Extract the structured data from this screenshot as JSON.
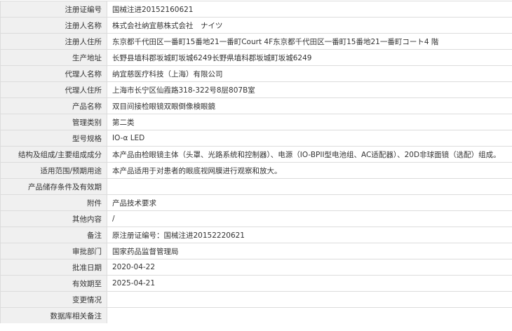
{
  "rows": [
    {
      "label": "注册证编号",
      "value": "国械注进20152160621"
    },
    {
      "label": "注册人名称",
      "value": "株式会社纳宜慈株式会社　ナイツ"
    },
    {
      "label": "注册人住所",
      "value": "东京都千代田区一番町15番地21一番町Court 4F东京都千代田区一番町15番地21一番町コート4 階"
    },
    {
      "label": "生产地址",
      "value": "长野县埴科郡坂城町坂城6249长野県埴科郡坂城町坂城6249"
    },
    {
      "label": "代理人名称",
      "value": "纳宜慈医疗科技（上海）有限公司"
    },
    {
      "label": "代理人住所",
      "value": "上海市长宁区仙霞路318-322号8层807B室"
    },
    {
      "label": "产品名称",
      "value": "双目间接检眼镜双眼倒像検眼鏡"
    },
    {
      "label": "管理类别",
      "value": "第二类"
    },
    {
      "label": "型号规格",
      "value": "IO-α LED"
    },
    {
      "label": "结构及组成/主要组成成分",
      "value": "本产品由检眼镜主体（头罩、光路系统和控制器）、电源（IO-BPII型电池组、AC适配器）、20D非球面镜（选配）组成。"
    },
    {
      "label": "适用范围/预期用途",
      "value": "本产品适用于对患者的眼底视网膜进行观察和放大。"
    },
    {
      "label": "产品储存条件及有效期",
      "value": ""
    },
    {
      "label": "附件",
      "value": "产品技术要求"
    },
    {
      "label": "其他内容",
      "value": "/"
    },
    {
      "label": "备注",
      "value": "原注册证编号：国械注进20152220621"
    },
    {
      "label": "审批部门",
      "value": "国家药品监督管理局"
    },
    {
      "label": "批准日期",
      "value": "2020-04-22"
    },
    {
      "label": "有效期至",
      "value": "2025-04-21"
    },
    {
      "label": "变更情况",
      "value": ""
    },
    {
      "label": "数据库相关备注",
      "value": ""
    }
  ]
}
